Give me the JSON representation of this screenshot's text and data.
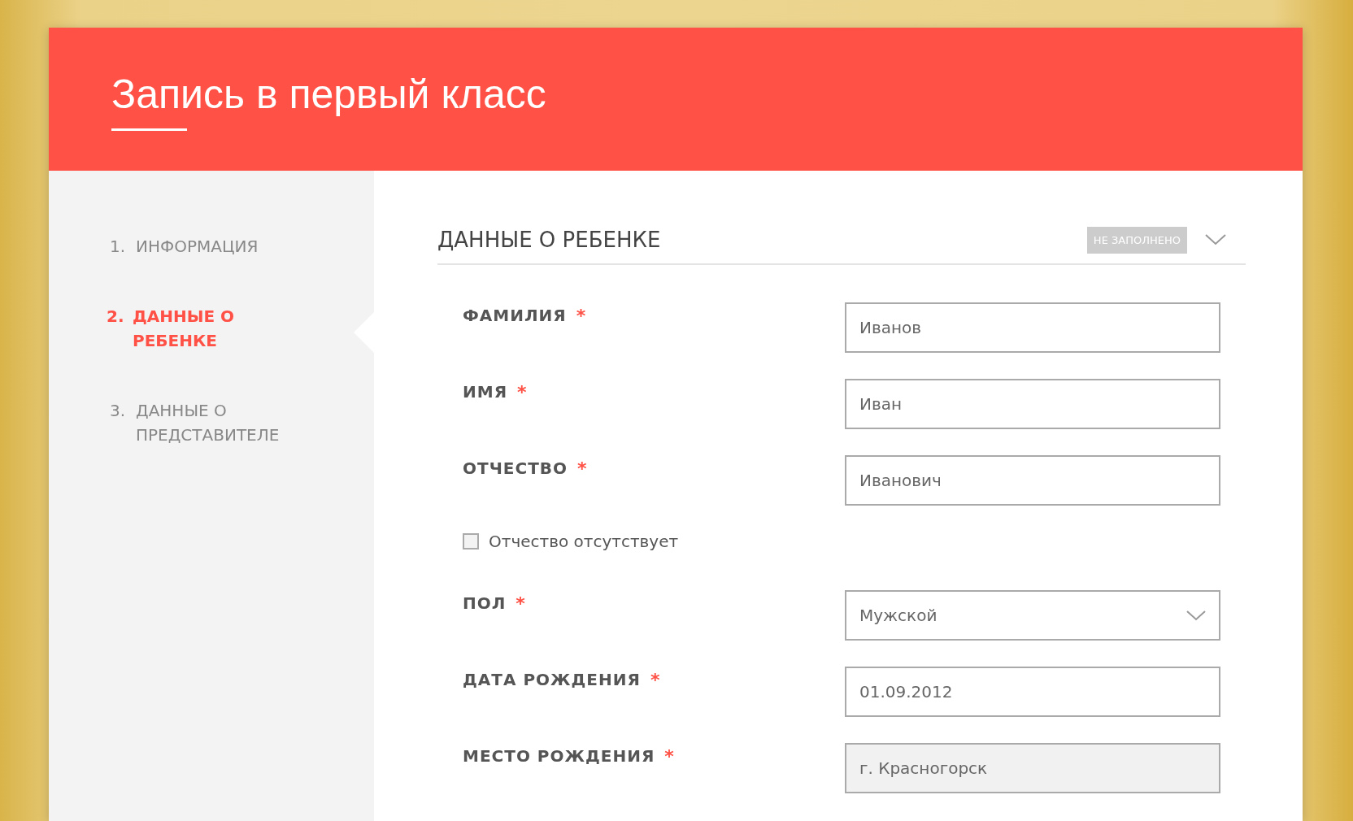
{
  "header": {
    "title": "Запись в первый класс"
  },
  "steps": [
    {
      "number": "1.",
      "label": "ИНФОРМАЦИЯ",
      "selected": false
    },
    {
      "number": "2.",
      "label": "ДАННЫЕ О РЕБЕНКЕ",
      "selected": true
    },
    {
      "number": "3.",
      "label": "ДАННЫЕ О ПРЕДСТАВИТЕЛЕ",
      "selected": false
    }
  ],
  "section": {
    "title": "ДАННЫЕ О РЕБЕНКЕ",
    "status": "НЕ ЗАПОЛНЕНО"
  },
  "fields": [
    {
      "kind": "input",
      "label": "ФАМИЛИЯ",
      "required_mark": "*",
      "value": "Иванов",
      "disabled": false
    },
    {
      "kind": "input",
      "label": "ИМЯ",
      "required_mark": "*",
      "value": "Иван",
      "disabled": false
    },
    {
      "kind": "input",
      "label": "ОТЧЕСТВО",
      "required_mark": "*",
      "value": "Иванович",
      "disabled": false
    },
    {
      "kind": "checkbox",
      "label": "Отчество отсутствует",
      "checked": false
    },
    {
      "kind": "select",
      "label": "ПОЛ",
      "required_mark": "*",
      "value": "Мужской",
      "disabled": false
    },
    {
      "kind": "input",
      "label": "ДАТА РОЖДЕНИЯ",
      "required_mark": "*",
      "value": "01.09.2012",
      "disabled": false
    },
    {
      "kind": "input",
      "label": "МЕСТО РОЖДЕНИЯ",
      "required_mark": "*",
      "value": "г. Красногорск",
      "disabled": true
    }
  ]
}
